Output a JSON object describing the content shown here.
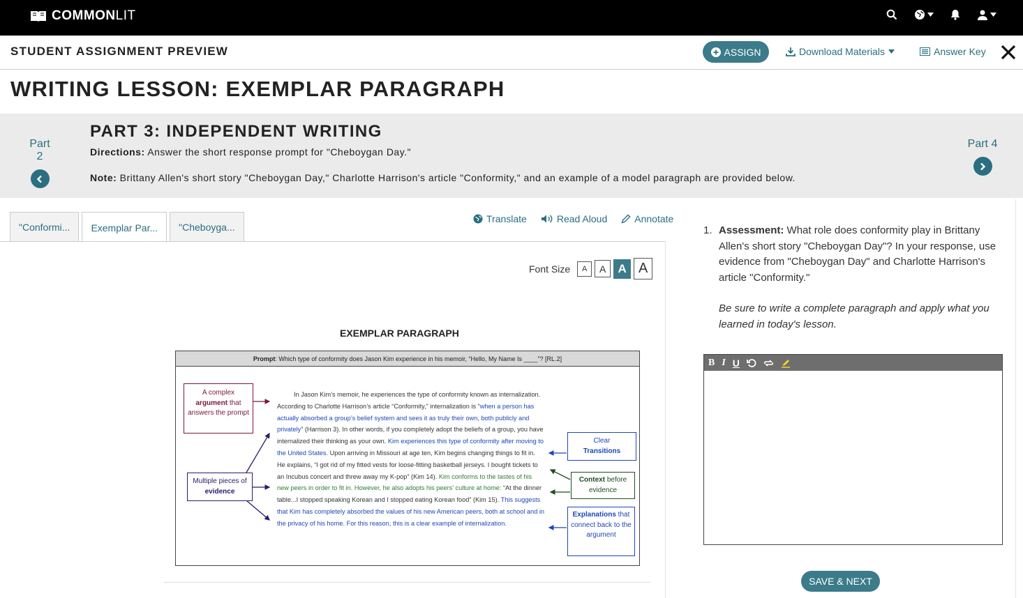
{
  "topbar": {
    "brand_bold": "COMMON",
    "brand_light": "LIT",
    "icons": [
      "search-icon",
      "globe-icon",
      "bell-icon",
      "user-icon"
    ]
  },
  "header": {
    "title": "STUDENT ASSIGNMENT PREVIEW",
    "assign_label": "ASSIGN",
    "download_label": "Download Materials",
    "answer_key_label": "Answer Key"
  },
  "lesson_title": "WRITING LESSON: EXEMPLAR PARAGRAPH",
  "part": {
    "prev_label": "Part 2",
    "next_label": "Part 4",
    "title": "PART 3: INDEPENDENT WRITING",
    "directions_label": "Directions:",
    "directions_text": " Answer the short response prompt for \"Cheboygan Day.\"",
    "note_label": "Note:",
    "note_text": " Brittany Allen's short story \"Cheboygan Day,\" Charlotte Harrison's article \"Conformity,\" and an example of a model paragraph are provided below."
  },
  "tabs": [
    {
      "label": "\"Conformi...",
      "active": false
    },
    {
      "label": "Exemplar Par...",
      "active": true
    },
    {
      "label": "\"Cheboyga...",
      "active": false
    }
  ],
  "tools": {
    "translate": "Translate",
    "read_aloud": "Read Aloud",
    "annotate": "Annotate"
  },
  "font_size": {
    "label": "Font Size",
    "options": [
      "A",
      "A",
      "A",
      "A"
    ],
    "selected_index": 2
  },
  "exemplar": {
    "heading": "EXEMPLAR PARAGRAPH",
    "prompt_label": "Prompt",
    "prompt_text": ": Which type of conformity does Jason Kim experience in his memoir, “Hello, My Name Is ____”? [RL.2]",
    "p1": "In Jason Kim’s memoir, he experiences the type of conformity known as internalization. According to Charlotte Harrison’s article “Conformity,” internalization is “",
    "p1b": "when a person has actually absorbed a group’s belief system and sees it as truly their own, both publicly and privately",
    "p1c": "” (Harrison 3). In other words, if you completely adopt the beliefs of a group, you have internalized their thinking as your own. ",
    "p2": "Kim experiences this type of conformity after moving to the United States.",
    "p3": " Upon arriving in Missouri at age ten, Kim begins changing things to fit in. He explains, “I got rid of my fitted vests for loose-fitting basketball jerseys. I bought tickets to an Incubus concert and threw away my K-pop” (Kim 14). ",
    "p4": "Kim conforms to the tastes of his new peers in order to fit in. However, he also adopts his peers’ culture at home:",
    "p5": " “At the dinner table...I stopped speaking Korean and I stopped eating Korean food” (Kim 15). ",
    "p6": "This suggests that Kim has completely absorbed the values of his new American peers, both at school and in the privacy of his home. For this reason, this is a clear example of internalization.",
    "labels": {
      "complex_a": "A complex",
      "complex_b": "argument",
      "complex_c": " that answers the prompt",
      "evidence_a": "Multiple pieces of ",
      "evidence_b": "evidence",
      "transitions_a": "Clear",
      "transitions_b": "Transitions",
      "context_a": "Context",
      "context_b": " before evidence",
      "explain_a": "Explanations",
      "explain_b": " that connect back to the argument"
    }
  },
  "question": {
    "number": "1.",
    "label": "Assessment:",
    "text": " What role does conformity play in Brittany Allen's short story \"Cheboygan Day\"? In your response, use evidence from \"Cheboygan Day\" and Charlotte Harrison's article \"Conformity.\"",
    "instruction": "Be sure to write a complete paragraph and apply what you learned in today's lesson."
  },
  "editor": {
    "tools": [
      "B",
      "I",
      "U"
    ],
    "value": ""
  },
  "save_label": "SAVE & NEXT",
  "colors": {
    "accent": "#3b7b8a",
    "link": "#2a6f80",
    "topbar": "#000000",
    "band": "#ebebeb"
  }
}
